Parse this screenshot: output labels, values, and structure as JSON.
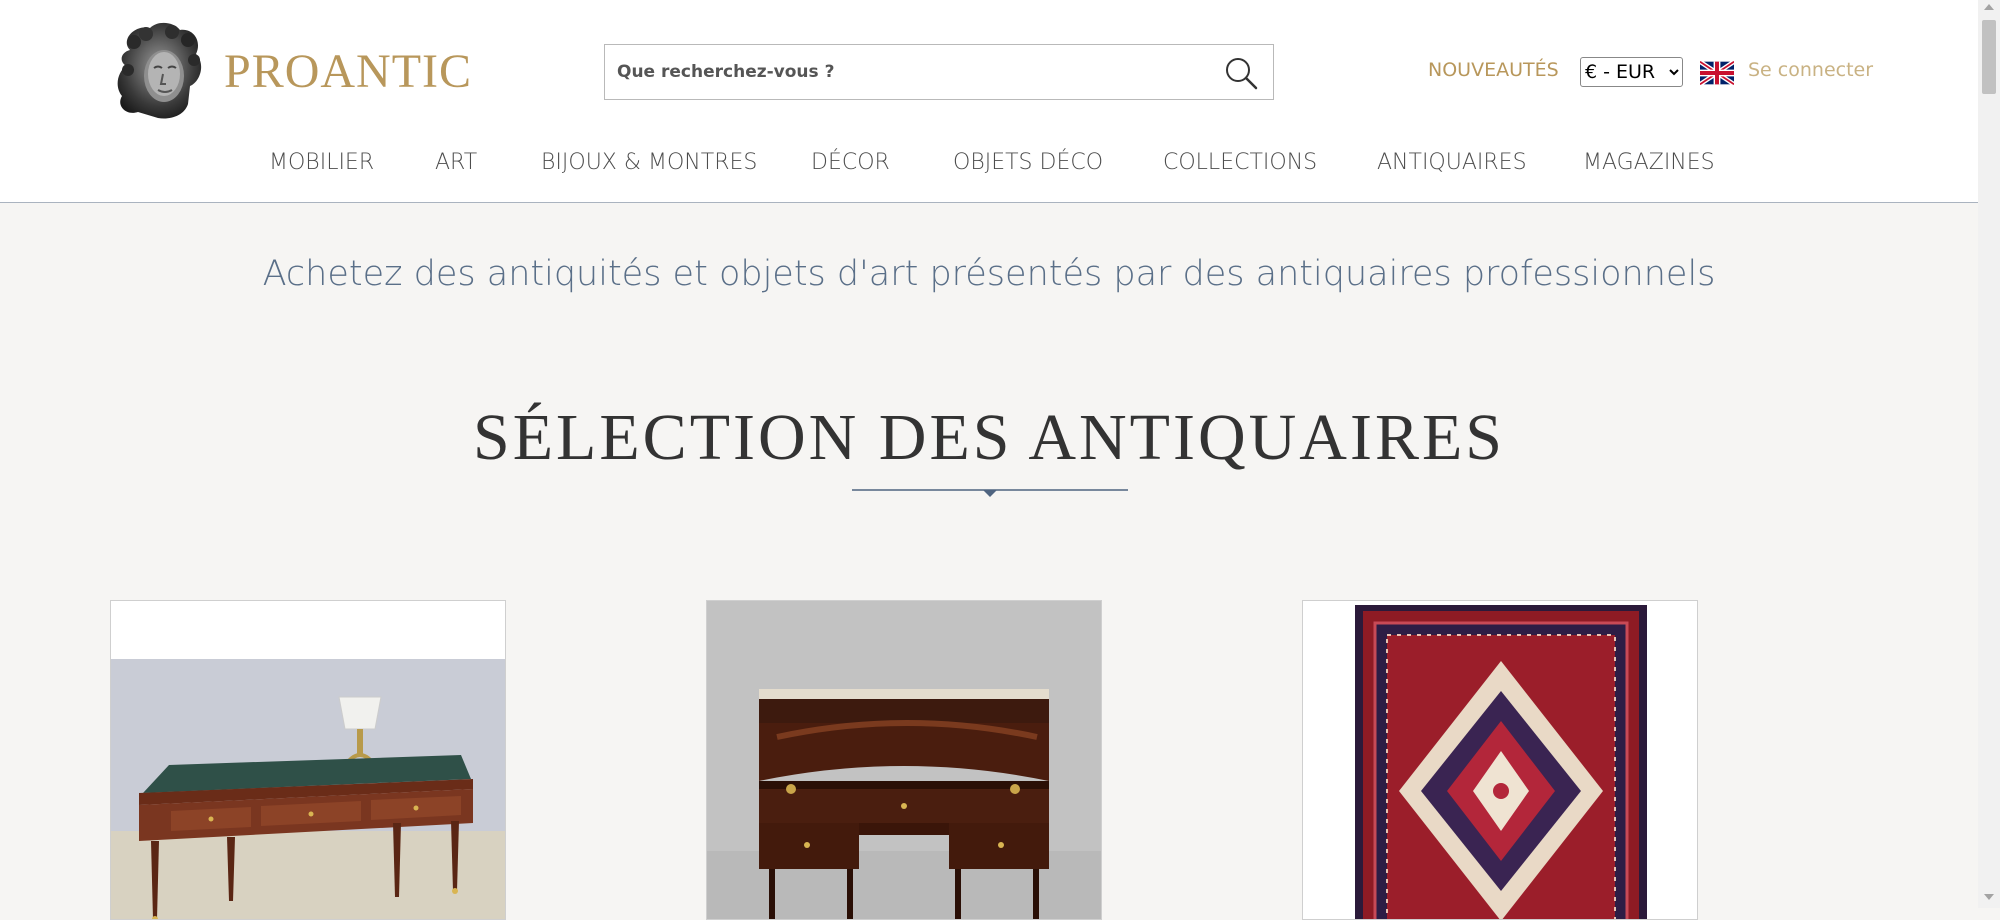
{
  "header": {
    "logo_text": "PROANTIC",
    "search_placeholder": "Que recherchez-vous ?",
    "news_label": "NOUVEAUTÉS",
    "currency": {
      "selected": "€ - EUR"
    },
    "language_flag": "uk-flag-icon",
    "login_label": "Se connecter"
  },
  "nav": {
    "items": [
      {
        "label": "MOBILIER"
      },
      {
        "label": "ART"
      },
      {
        "label": "BIJOUX & MONTRES"
      },
      {
        "label": "DÉCOR"
      },
      {
        "label": "OBJETS DÉCO"
      },
      {
        "label": "COLLECTIONS"
      },
      {
        "label": "ANTIQUAIRES"
      },
      {
        "label": "MAGAZINES"
      }
    ]
  },
  "main": {
    "tagline": "Achetez des antiquités et objets d'art présentés par des antiquaires professionnels",
    "section_title": "SÉLECTION DES ANTIQUAIRES",
    "cards": [
      {
        "image": "writing-desk-photo"
      },
      {
        "image": "cylinder-desk-photo"
      },
      {
        "image": "persian-rug-photo"
      }
    ]
  },
  "colors": {
    "brand_gold": "#b8975b",
    "tagline_blue": "#5a6f88",
    "page_bg": "#f6f5f3"
  }
}
